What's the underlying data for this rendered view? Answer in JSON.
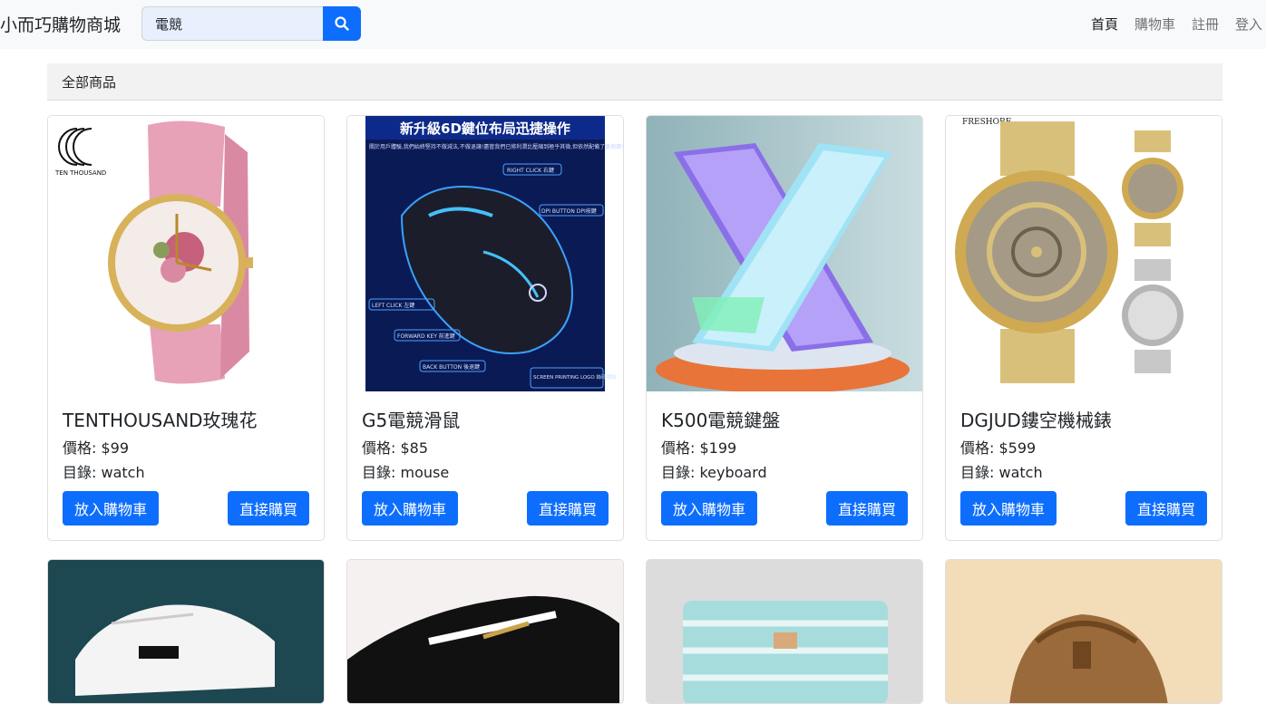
{
  "nav": {
    "brand": "小而巧購物商城",
    "search_value": "電競",
    "links": [
      {
        "label": "首頁",
        "active": true
      },
      {
        "label": "購物車",
        "active": false
      },
      {
        "label": "註冊",
        "active": false
      },
      {
        "label": "登入",
        "active": false
      }
    ]
  },
  "breadcrumb": "全部商品",
  "products": [
    {
      "name": "TENTHOUSAND玫瑰花",
      "price": "價格: $99",
      "category": "目錄: watch",
      "add_to_cart": "放入購物車",
      "buy_now": "直接購買",
      "image_logo_text": "TEN THOUSAND"
    },
    {
      "name": "G5電競滑鼠",
      "price": "價格: $85",
      "category": "目錄: mouse",
      "add_to_cart": "放入購物車",
      "buy_now": "直接購買",
      "image_headline": "新升級6D鍵位布局迅捷操作",
      "image_subtext": "關於用戶體驗,我們始終堅持不做減法,不做退讓!盡管我們已將利潤比壓縮到極乎其微,但依然配備了雙側鍵!讓你日常操作快人一步!",
      "image_callouts": [
        "RIGHT CLICK 右鍵",
        "DPI BUTTON DPI按鍵",
        "LEFT CLICK 左鍵",
        "FORWARD KEY 前進鍵",
        "BACK BUTTON 後退鍵",
        "SCREEN PRINTING LOGO 絲印標誌"
      ]
    },
    {
      "name": "K500電競鍵盤",
      "price": "價格: $199",
      "category": "目錄: keyboard",
      "add_to_cart": "放入購物車",
      "buy_now": "直接購買"
    },
    {
      "name": "DGJUD鏤空機械錶",
      "price": "價格: $599",
      "category": "目錄: watch",
      "add_to_cart": "放入購物車",
      "buy_now": "直接購買",
      "image_logo_text": "FRESHORE"
    }
  ]
}
